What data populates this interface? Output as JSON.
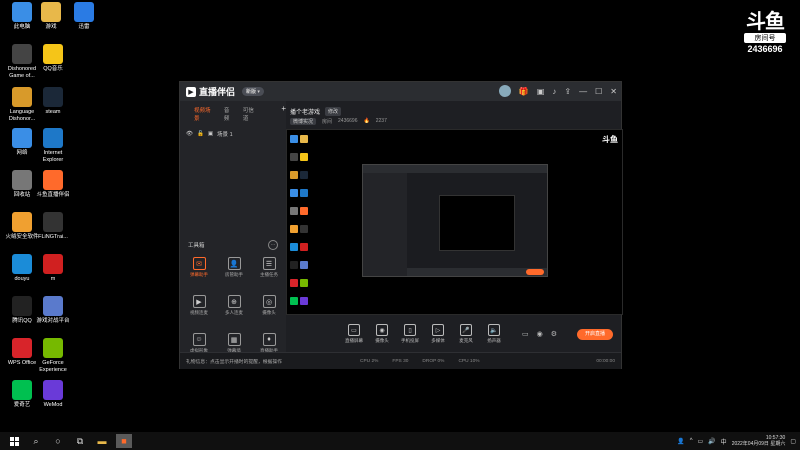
{
  "desktop": {
    "icons": [
      {
        "label": "此电脑",
        "icon": "computer-icon",
        "color": "#3a8ee6"
      },
      {
        "label": "游戏",
        "icon": "folder-icon",
        "color": "#e8b84a"
      },
      {
        "label": "迅雷",
        "icon": "thunder-icon",
        "color": "#2a7be4"
      },
      {
        "label": "Dishonored\nGame of...",
        "icon": "game-icon",
        "color": "#444"
      },
      {
        "label": "QQ音乐",
        "icon": "music-icon",
        "color": "#f5c518"
      },
      {
        "label": "Language\nDishonor...",
        "icon": "app-icon",
        "color": "#d89a2a"
      },
      {
        "label": "steam",
        "icon": "steam-icon",
        "color": "#1b2838"
      },
      {
        "label": "网络",
        "icon": "network-icon",
        "color": "#3a8ee6"
      },
      {
        "label": "Internet\nExplorer",
        "icon": "ie-icon",
        "color": "#1e78c8"
      },
      {
        "label": "回收站",
        "icon": "trash-icon",
        "color": "#777"
      },
      {
        "label": "斗鱼直播伴侣",
        "icon": "douyu-icon",
        "color": "#ff6a2b"
      },
      {
        "label": "火绒安全软件",
        "icon": "shield-icon",
        "color": "#f0a030"
      },
      {
        "label": "FLiNGTrai...",
        "icon": "trainer-icon",
        "color": "#333"
      },
      {
        "label": "douyu",
        "icon": "edge-icon",
        "color": "#1b8cd8"
      },
      {
        "label": "m",
        "icon": "app-icon",
        "color": "#d02020"
      },
      {
        "label": "腾讯QQ",
        "icon": "qq-icon",
        "color": "#222"
      },
      {
        "label": "游戏对战平台",
        "icon": "platform-icon",
        "color": "#5a7acc"
      },
      {
        "label": "WPS Office",
        "icon": "wps-icon",
        "color": "#d8242a"
      },
      {
        "label": "GeForce\nExperience",
        "icon": "nvidia-icon",
        "color": "#76b900"
      },
      {
        "label": "爱奇艺",
        "icon": "iqiyi-icon",
        "color": "#00c050"
      },
      {
        "label": "WeMod",
        "icon": "wemod-icon",
        "color": "#6a3ad8"
      }
    ]
  },
  "watermark": {
    "logo": "斗鱼",
    "sub": "房间号",
    "room": "2436696"
  },
  "app": {
    "title": "直播伴侣",
    "version": "新版 ▾",
    "tabs": [
      {
        "label": "视频场景",
        "active": true
      },
      {
        "label": "音频",
        "active": false
      },
      {
        "label": "可信道",
        "active": false
      }
    ],
    "scene_label": "场景 1",
    "room_title": "播个老游戏",
    "room_edit": "修改",
    "room_category": "微博实况",
    "room_id_label": "房间",
    "room_id": "2436696",
    "room_heat": "2237",
    "tools_title": "工具箱",
    "tools": [
      {
        "label": "弹幕助手",
        "icon": "danmu-icon",
        "hot": true
      },
      {
        "label": "房管助手",
        "icon": "admin-icon",
        "hot": false
      },
      {
        "label": "主播任务",
        "icon": "task-icon",
        "hot": false
      },
      {
        "label": "视频连麦",
        "icon": "video-call-icon",
        "hot": false
      },
      {
        "label": "多人连麦",
        "icon": "multi-call-icon",
        "hot": false
      },
      {
        "label": "摄像头",
        "icon": "camera-icon",
        "hot": false
      },
      {
        "label": "虚拟形象",
        "icon": "avatar-icon",
        "hot": false
      },
      {
        "label": "弹幕墙",
        "icon": "wall-icon",
        "hot": false
      },
      {
        "label": "直播助手",
        "icon": "helper-icon",
        "hot": false
      }
    ],
    "controls": [
      {
        "label": "直播屏幕",
        "icon": "screen-icon"
      },
      {
        "label": "摄像头",
        "icon": "camera-icon"
      },
      {
        "label": "手机投屏",
        "icon": "phone-icon"
      },
      {
        "label": "多媒体",
        "icon": "media-icon"
      },
      {
        "label": "麦克风",
        "icon": "mic-icon"
      },
      {
        "label": "扬声器",
        "icon": "speaker-icon"
      }
    ],
    "start_button": "开启直播",
    "status": {
      "message": "礼物信息：点击显示开播时的提醒，根据操作",
      "items": [
        "CPU 2%",
        "FPS 30",
        "DROP 0%",
        "CPU 10%",
        "00:00:00"
      ]
    }
  },
  "taskbar": {
    "time": "10:57:30",
    "date": "2022年04月09日 星期六",
    "ime": "中"
  }
}
